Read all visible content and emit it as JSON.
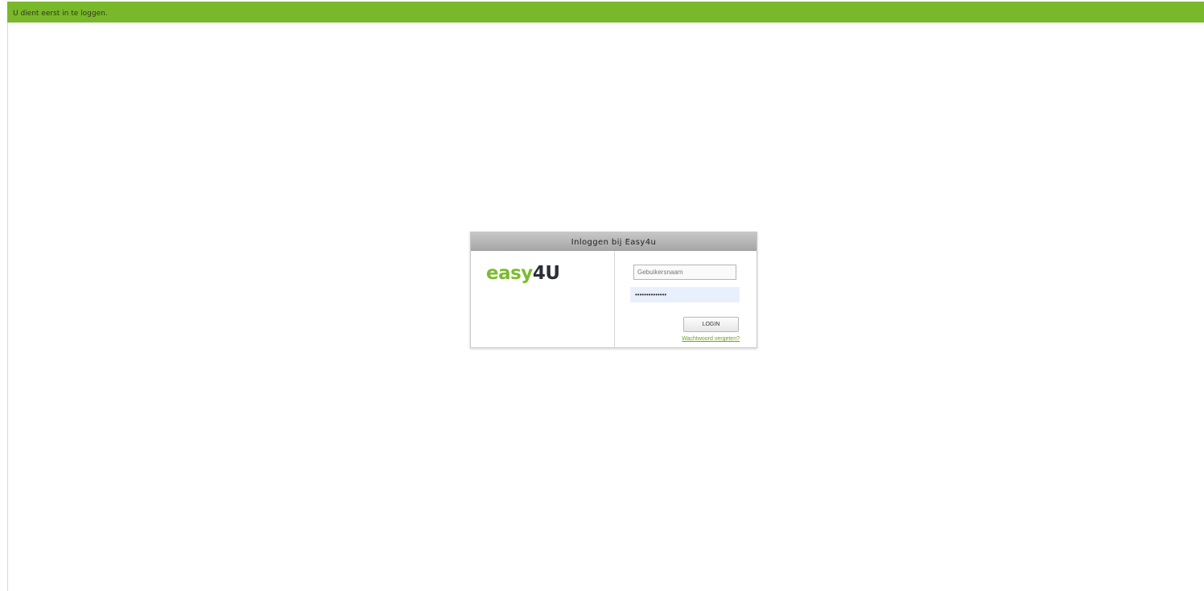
{
  "notice": {
    "text": "U dient eerst in te loggen."
  },
  "login": {
    "title": "Inloggen bij Easy4u",
    "logo_part1": "easy",
    "logo_part2": "4U",
    "username_placeholder": "Gebuikersnaam",
    "username_value": "",
    "password_value": "••••••••••••••",
    "button_label": "LOGIN",
    "forgot_link": "Wachtwoord vergeten?"
  },
  "colors": {
    "accent_green": "#78b82a",
    "logo_dark": "#2b2f36",
    "autofill_bg": "#e8f0fe"
  }
}
